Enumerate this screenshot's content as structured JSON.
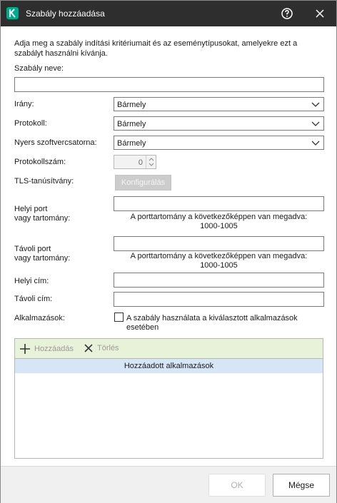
{
  "window": {
    "title": "Szabály hozzáadása",
    "help_icon": "help-circle-icon",
    "close_icon": "close-icon"
  },
  "intro": "Adja meg a szabály indítási kritériumait és az eseménytípusokat, amelyekre ezt a szabályt használni kívánja.",
  "rule_name": {
    "label": "Szabály neve:",
    "value": ""
  },
  "direction": {
    "label": "Irány:",
    "value": "Bármely"
  },
  "protocol": {
    "label": "Protokoll:",
    "value": "Bármely"
  },
  "raw_socket": {
    "label": "Nyers szoftvercsatorna:",
    "value": "Bármely"
  },
  "protocol_number": {
    "label": "Protokollszám:",
    "value": "0"
  },
  "tls": {
    "label": "TLS-tanúsítvány:",
    "button": "Konfigurálás"
  },
  "local_port": {
    "label_line1": "Helyi port",
    "label_line2": "vagy tartomány:",
    "value": "",
    "hint_line1": "A porttartomány a következőképpen van megadva:",
    "hint_line2": "1000-1005"
  },
  "remote_port": {
    "label_line1": "Távoli port",
    "label_line2": "vagy tartomány:",
    "value": "",
    "hint_line1": "A porttartomány a következőképpen van megadva:",
    "hint_line2": "1000-1005"
  },
  "local_address": {
    "label": "Helyi cím:",
    "value": ""
  },
  "remote_address": {
    "label": "Távoli cím:",
    "value": ""
  },
  "applications": {
    "label": "Alkalmazások:",
    "checkbox_label": "A szabály használata a kiválasztott alkalmazások esetében",
    "checked": false
  },
  "toolbar": {
    "add_label": "Hozzáadás",
    "delete_label": "Törlés"
  },
  "list": {
    "header": "Hozzáadott alkalmazások",
    "items": []
  },
  "footer": {
    "ok_label": "OK",
    "cancel_label": "Mégse"
  },
  "colors": {
    "titlebar": "#2e2e2e",
    "brand": "#00a88e",
    "toolbar_bg": "#e8f2d8",
    "list_header_bg": "#d7e6f6"
  }
}
